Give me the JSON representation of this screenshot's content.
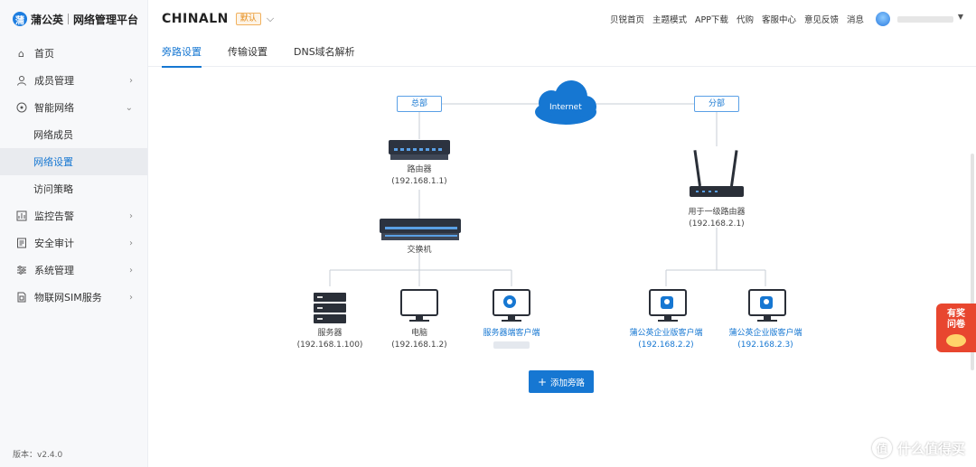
{
  "brand": {
    "logo": "蒲",
    "name": "蒲公英",
    "sub": "网络管理平台"
  },
  "sidebar": {
    "items": [
      {
        "label": "首页",
        "icon": "home-icon"
      },
      {
        "label": "成员管理",
        "icon": "user-icon"
      },
      {
        "label": "智能网络",
        "icon": "network-icon"
      },
      {
        "label": "网络成员"
      },
      {
        "label": "网络设置"
      },
      {
        "label": "访问策略"
      },
      {
        "label": "监控告警",
        "icon": "monitor-icon"
      },
      {
        "label": "安全审计",
        "icon": "audit-icon"
      },
      {
        "label": "系统管理",
        "icon": "settings-icon"
      },
      {
        "label": "物联网SIM服务",
        "icon": "sim-icon"
      }
    ],
    "version": "版本：v2.4.0"
  },
  "header": {
    "network_name": "CHINALN",
    "badge": "默认",
    "links": [
      "贝锐首页",
      "主题模式",
      "APP下载",
      "代购",
      "客服中心",
      "意见反馈",
      "消息"
    ]
  },
  "tabs": [
    "旁路设置",
    "传输设置",
    "DNS域名解析"
  ],
  "diagram": {
    "internet": "Internet",
    "hq": "总部",
    "branch": "分部",
    "router": {
      "name": "路由器",
      "ip": "(192.168.1.1)"
    },
    "switch": {
      "name": "交换机"
    },
    "server": {
      "name": "服务器",
      "ip": "(192.168.1.100)"
    },
    "pc": {
      "name": "电脑",
      "ip": "(192.168.1.2)"
    },
    "server_client": {
      "name": "服务器端客户端"
    },
    "branch_router": {
      "name": "用于一级路由器",
      "ip": "(192.168.2.1)"
    },
    "client1": {
      "name": "蒲公英企业版客户端",
      "ip": "(192.168.2.2)"
    },
    "client2": {
      "name": "蒲公英企业版客户端",
      "ip": "(192.168.2.3)"
    }
  },
  "add_button": "添加旁路",
  "promo": {
    "line1": "有奖",
    "line2": "问卷"
  },
  "watermark": "什么值得买",
  "colors": {
    "accent": "#1677d2",
    "badge": "#e58b19"
  }
}
